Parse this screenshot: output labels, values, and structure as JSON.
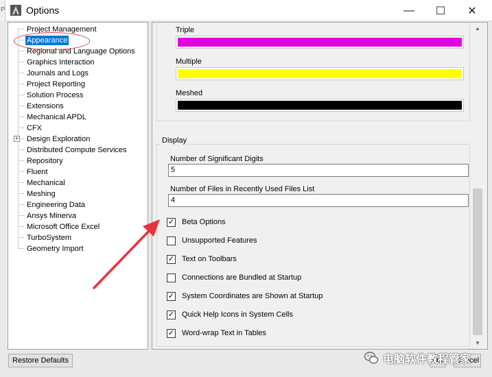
{
  "window": {
    "title": "Options",
    "left_stub_text": "P",
    "minimize_glyph": "—",
    "maximize_glyph": "☐",
    "close_glyph": "✕"
  },
  "tree": {
    "selected": "Appearance",
    "expandable_glyph": "+",
    "items": [
      {
        "label": "Project Management"
      },
      {
        "label": "Appearance"
      },
      {
        "label": "Regional and Language Options"
      },
      {
        "label": "Graphics Interaction"
      },
      {
        "label": "Journals and Logs"
      },
      {
        "label": "Project Reporting"
      },
      {
        "label": "Solution Process"
      },
      {
        "label": "Extensions"
      },
      {
        "label": "Mechanical APDL"
      },
      {
        "label": "CFX"
      },
      {
        "label": "Design Exploration"
      },
      {
        "label": "Distributed Compute Services"
      },
      {
        "label": "Repository"
      },
      {
        "label": "Fluent"
      },
      {
        "label": "Mechanical"
      },
      {
        "label": "Meshing"
      },
      {
        "label": "Engineering Data"
      },
      {
        "label": "Ansys Minerva"
      },
      {
        "label": "Microsoft Office Excel"
      },
      {
        "label": "TurboSystem"
      },
      {
        "label": "Geometry Import"
      }
    ]
  },
  "colors": [
    {
      "label": "Triple",
      "hex": "#e000e0"
    },
    {
      "label": "Multiple",
      "hex": "#ffff00"
    },
    {
      "label": "Meshed",
      "hex": "#000000"
    }
  ],
  "display": {
    "title": "Display",
    "sig_digits_label": "Number of Significant Digits",
    "sig_digits_value": "5",
    "recent_files_label": "Number of Files in Recently Used Files List",
    "recent_files_value": "4",
    "check_glyph": "✓",
    "checkboxes": [
      {
        "label": "Beta Options",
        "checked": true
      },
      {
        "label": "Unsupported Features",
        "checked": false
      },
      {
        "label": "Text on Toolbars",
        "checked": true
      },
      {
        "label": "Connections are Bundled at Startup",
        "checked": false
      },
      {
        "label": "System Coordinates are Shown at Startup",
        "checked": true
      },
      {
        "label": "Quick Help Icons in System Cells",
        "checked": true
      },
      {
        "label": "Word-wrap Text in Tables",
        "checked": true
      }
    ]
  },
  "buttons": {
    "restore": "Restore Defaults",
    "ok": "OK",
    "cancel": "Cancel"
  },
  "watermark": {
    "text": "电脑软件教程管家"
  },
  "accent_colors": {
    "selection": "#0078d7",
    "annotation_red": "#e8323c"
  },
  "scroll": {
    "up_glyph": "▲",
    "down_glyph": "▼"
  }
}
